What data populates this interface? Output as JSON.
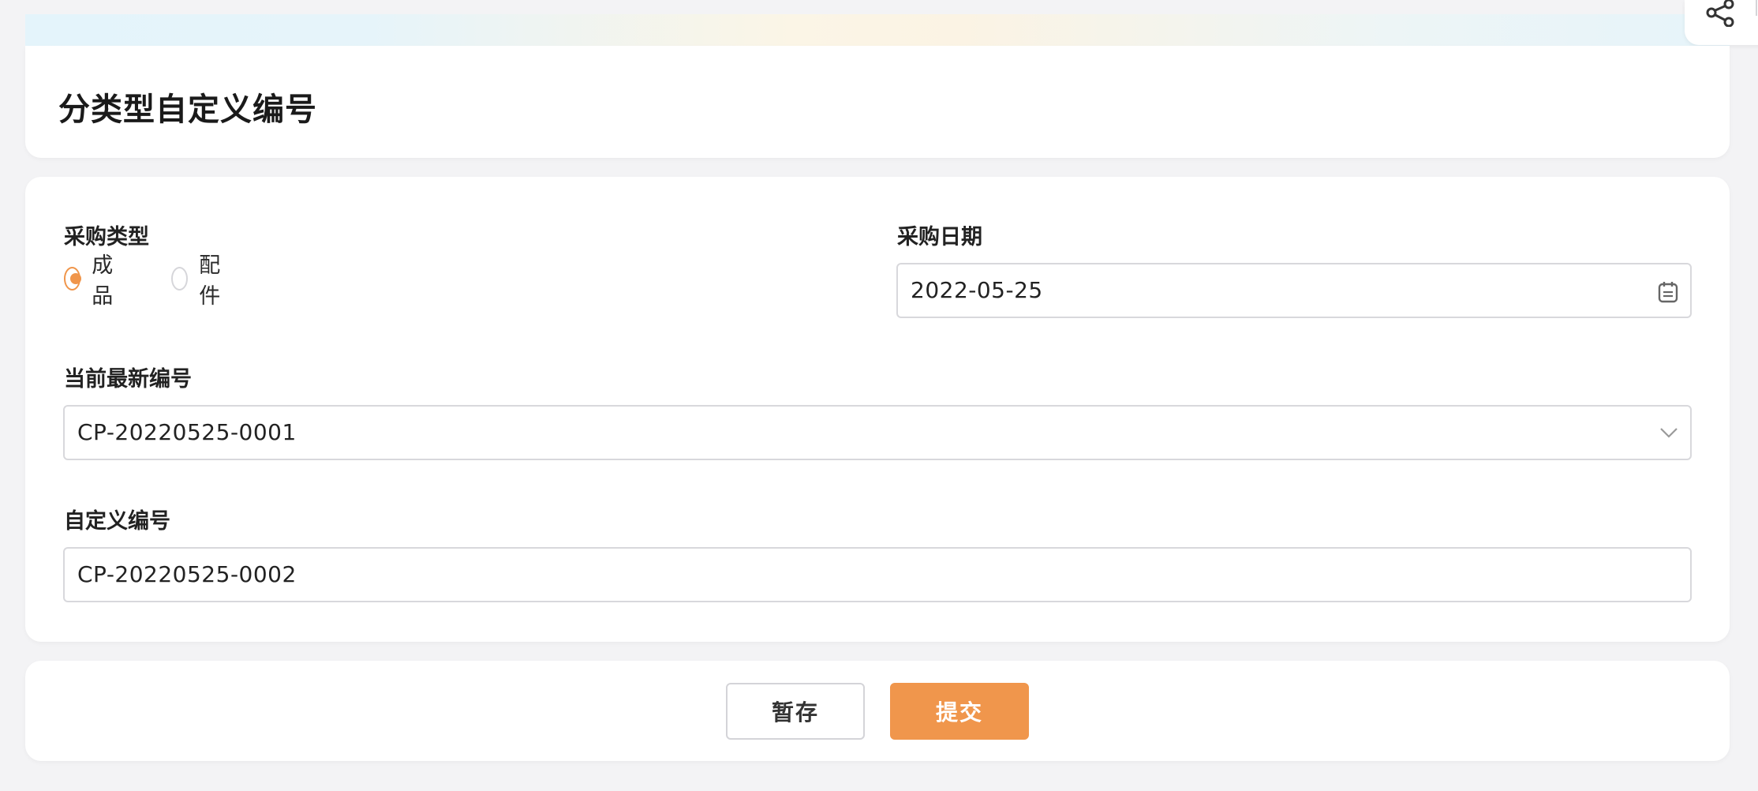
{
  "header": {
    "title": "分类型自定义编号",
    "share_icon": "share-icon"
  },
  "form": {
    "purchase_type": {
      "label": "采购类型",
      "options": [
        {
          "label": "成品",
          "checked": true
        },
        {
          "label": "配件",
          "checked": false
        }
      ]
    },
    "purchase_date": {
      "label": "采购日期",
      "value": "2022-05-25",
      "icon": "calendar-icon"
    },
    "latest_number": {
      "label": "当前最新编号",
      "value": "CP-20220525-0001",
      "icon": "chevron-down-icon"
    },
    "custom_number": {
      "label": "自定义编号",
      "value": "CP-20220525-0002"
    }
  },
  "actions": {
    "save_label": "暂存",
    "submit_label": "提交"
  },
  "colors": {
    "accent": "#f0954a",
    "background": "#f3f3f5",
    "card": "#ffffff"
  }
}
